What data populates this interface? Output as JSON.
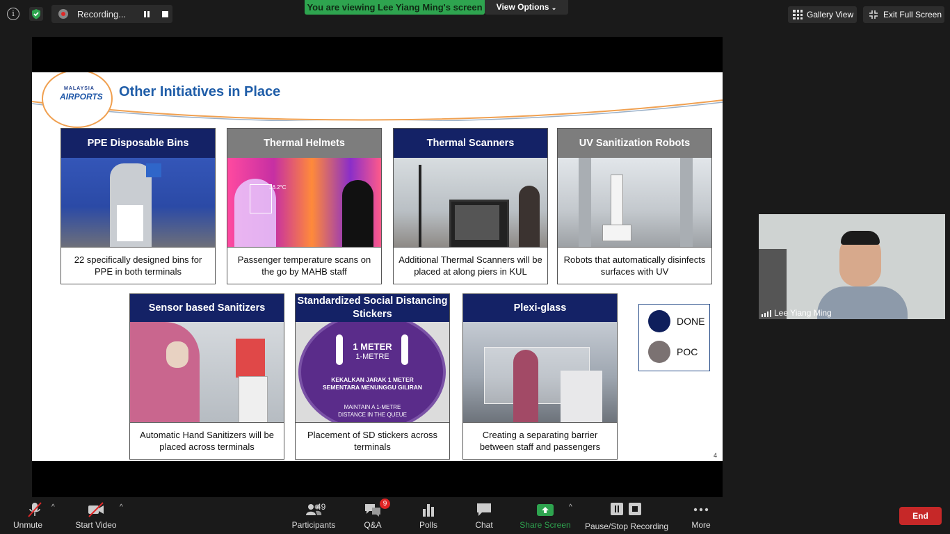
{
  "topbar": {
    "recording_label": "Recording...",
    "viewing_banner": "You are viewing Lee Yiang Ming's screen",
    "view_options": "View Options",
    "gallery_view": "Gallery View",
    "exit_full_screen": "Exit Full Screen"
  },
  "slide": {
    "logo_line1": "MALAYSIA",
    "logo_line2": "AIRPORTS",
    "title": "Other Initiatives in Place",
    "cards": [
      {
        "title": "PPE Disposable Bins",
        "caption": "22 specifically designed bins for PPE in both terminals",
        "status": "done"
      },
      {
        "title": "Thermal Helmets",
        "caption": "Passenger temperature scans on the go by MAHB staff",
        "status": "poc",
        "image_text": "36.2°C"
      },
      {
        "title": "Thermal Scanners",
        "caption": "Additional Thermal Scanners will be placed at along piers in KUL",
        "status": "done"
      },
      {
        "title": "UV Sanitization Robots",
        "caption": "Robots that automatically disinfects surfaces with UV",
        "status": "poc"
      },
      {
        "title": "Sensor based Sanitizers",
        "caption": "Automatic Hand Sanitizers will be placed across terminals",
        "status": "done"
      },
      {
        "title": "Standardized Social Distancing Stickers",
        "caption": "Placement of SD stickers across terminals",
        "status": "done",
        "sticker_lines": [
          "1 METER",
          "1-METRE",
          "KEKALKAN JARAK 1 METER",
          "SEMENTARA MENUNGGU GILIRAN",
          "MAINTAIN A 1-METRE",
          "DISTANCE IN THE QUEUE"
        ]
      },
      {
        "title": "Plexi-glass",
        "caption": "Creating a separating barrier between staff and passengers",
        "status": "done"
      }
    ],
    "legend": [
      {
        "label": "DONE",
        "color": "#0f1f5c"
      },
      {
        "label": "POC",
        "color": "#7b7272"
      }
    ],
    "page_number": "4"
  },
  "participant": {
    "name": "Lee Yiang Ming"
  },
  "toolbar": {
    "unmute": "Unmute",
    "start_video": "Start Video",
    "participants": "Participants",
    "participants_count": "49",
    "qa": "Q&A",
    "qa_badge": "9",
    "polls": "Polls",
    "chat": "Chat",
    "share_screen": "Share Screen",
    "pause_stop_recording": "Pause/Stop Recording",
    "more": "More",
    "end": "End"
  },
  "colors": {
    "navy_header": "#142266",
    "gray_header": "#7d7d7d",
    "share_green": "#2ea44f",
    "end_red": "#c62828"
  }
}
